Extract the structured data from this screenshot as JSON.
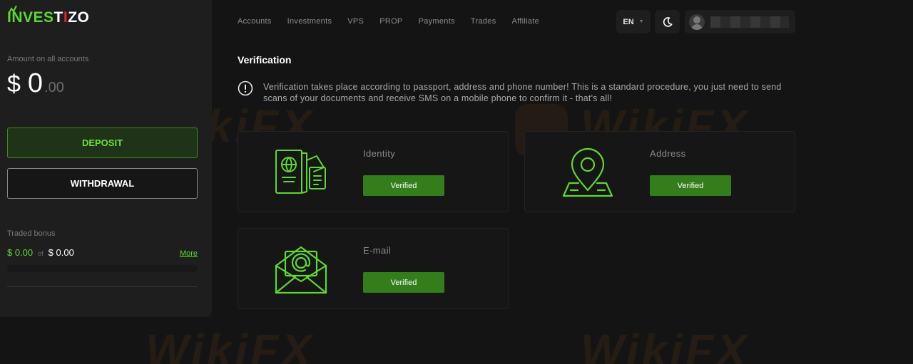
{
  "brand": {
    "logo_text_green": "INVES",
    "logo_text_white": "T",
    "logo_text_green2": "I",
    "logo_text_white2": "ZO"
  },
  "sidebar": {
    "balance_label": "Amount on all accounts",
    "balance_currency": "$",
    "balance_int": "0",
    "balance_dec": ".00",
    "deposit_label": "DEPOSIT",
    "withdrawal_label": "WITHDRAWAL",
    "bonus_label": "Traded bonus",
    "bonus_value": "$ 0.00",
    "bonus_of": "of",
    "bonus_total": "$ 0.00",
    "bonus_more": "More",
    "bonus_progress": 0
  },
  "nav": [
    {
      "label": "Accounts"
    },
    {
      "label": "Investments"
    },
    {
      "label": "VPS"
    },
    {
      "label": "PROP"
    },
    {
      "label": "Payments"
    },
    {
      "label": "Trades"
    },
    {
      "label": "Affiliate"
    }
  ],
  "header": {
    "language": "EN",
    "theme_icon": "moon-icon",
    "avatar_icon": "user-avatar-icon"
  },
  "main": {
    "title": "Verification",
    "notice": "Verification takes place according to passport, address and phone number! This is a standard procedure, you just need to send scans of your documents and receive SMS on a mobile phone to confirm it - that's all!",
    "cards": [
      {
        "name": "Identity",
        "status": "Verified",
        "icon": "passport-icon"
      },
      {
        "name": "Address",
        "status": "Verified",
        "icon": "location-pin-icon"
      },
      {
        "name": "E-mail",
        "status": "Verified",
        "icon": "envelope-icon"
      }
    ]
  },
  "colors": {
    "accent": "#5ed82c",
    "verified_bg": "#337e1b",
    "bg": "#141414",
    "panel": "#1e1e1e"
  },
  "watermark": "WikiFX"
}
